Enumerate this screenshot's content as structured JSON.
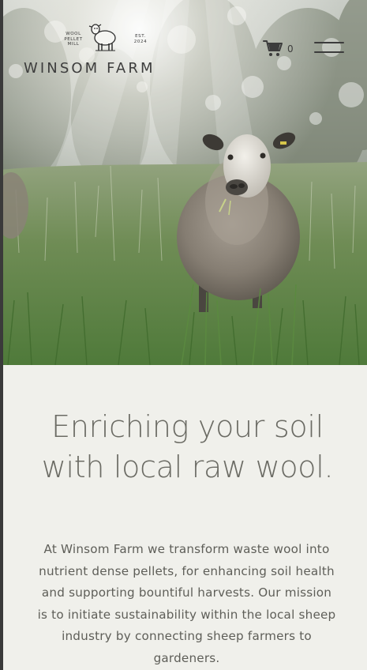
{
  "header": {
    "logo": {
      "left_text": [
        "WOOL",
        "PELLET",
        "MILL"
      ],
      "right_text": [
        "EST.",
        "2024"
      ],
      "name": "WINSOM FARM"
    },
    "cart": {
      "icon": "cart-icon",
      "count": "0"
    },
    "menu": {
      "icon": "hamburger-menu-icon"
    }
  },
  "hero": {
    "image": "sheep-in-grass-photo"
  },
  "intro": {
    "headline_line1": "Enriching your soil",
    "headline_line2": "with local raw wool.",
    "mission_lines": [
      "At Winsom Farm we transform waste wool into",
      "nutrient dense pellets, for enhancing soil health",
      "and supporting bountiful harvests. Our mission",
      "is to initiate sustainability within the local sheep",
      "industry by connecting sheep farmers to",
      "gardeners."
    ]
  },
  "colors": {
    "page_background": "#f0f0eb",
    "headline_text": "#6b6b64",
    "body_text": "#5e5e58",
    "header_icons": "#3c3c3c"
  }
}
